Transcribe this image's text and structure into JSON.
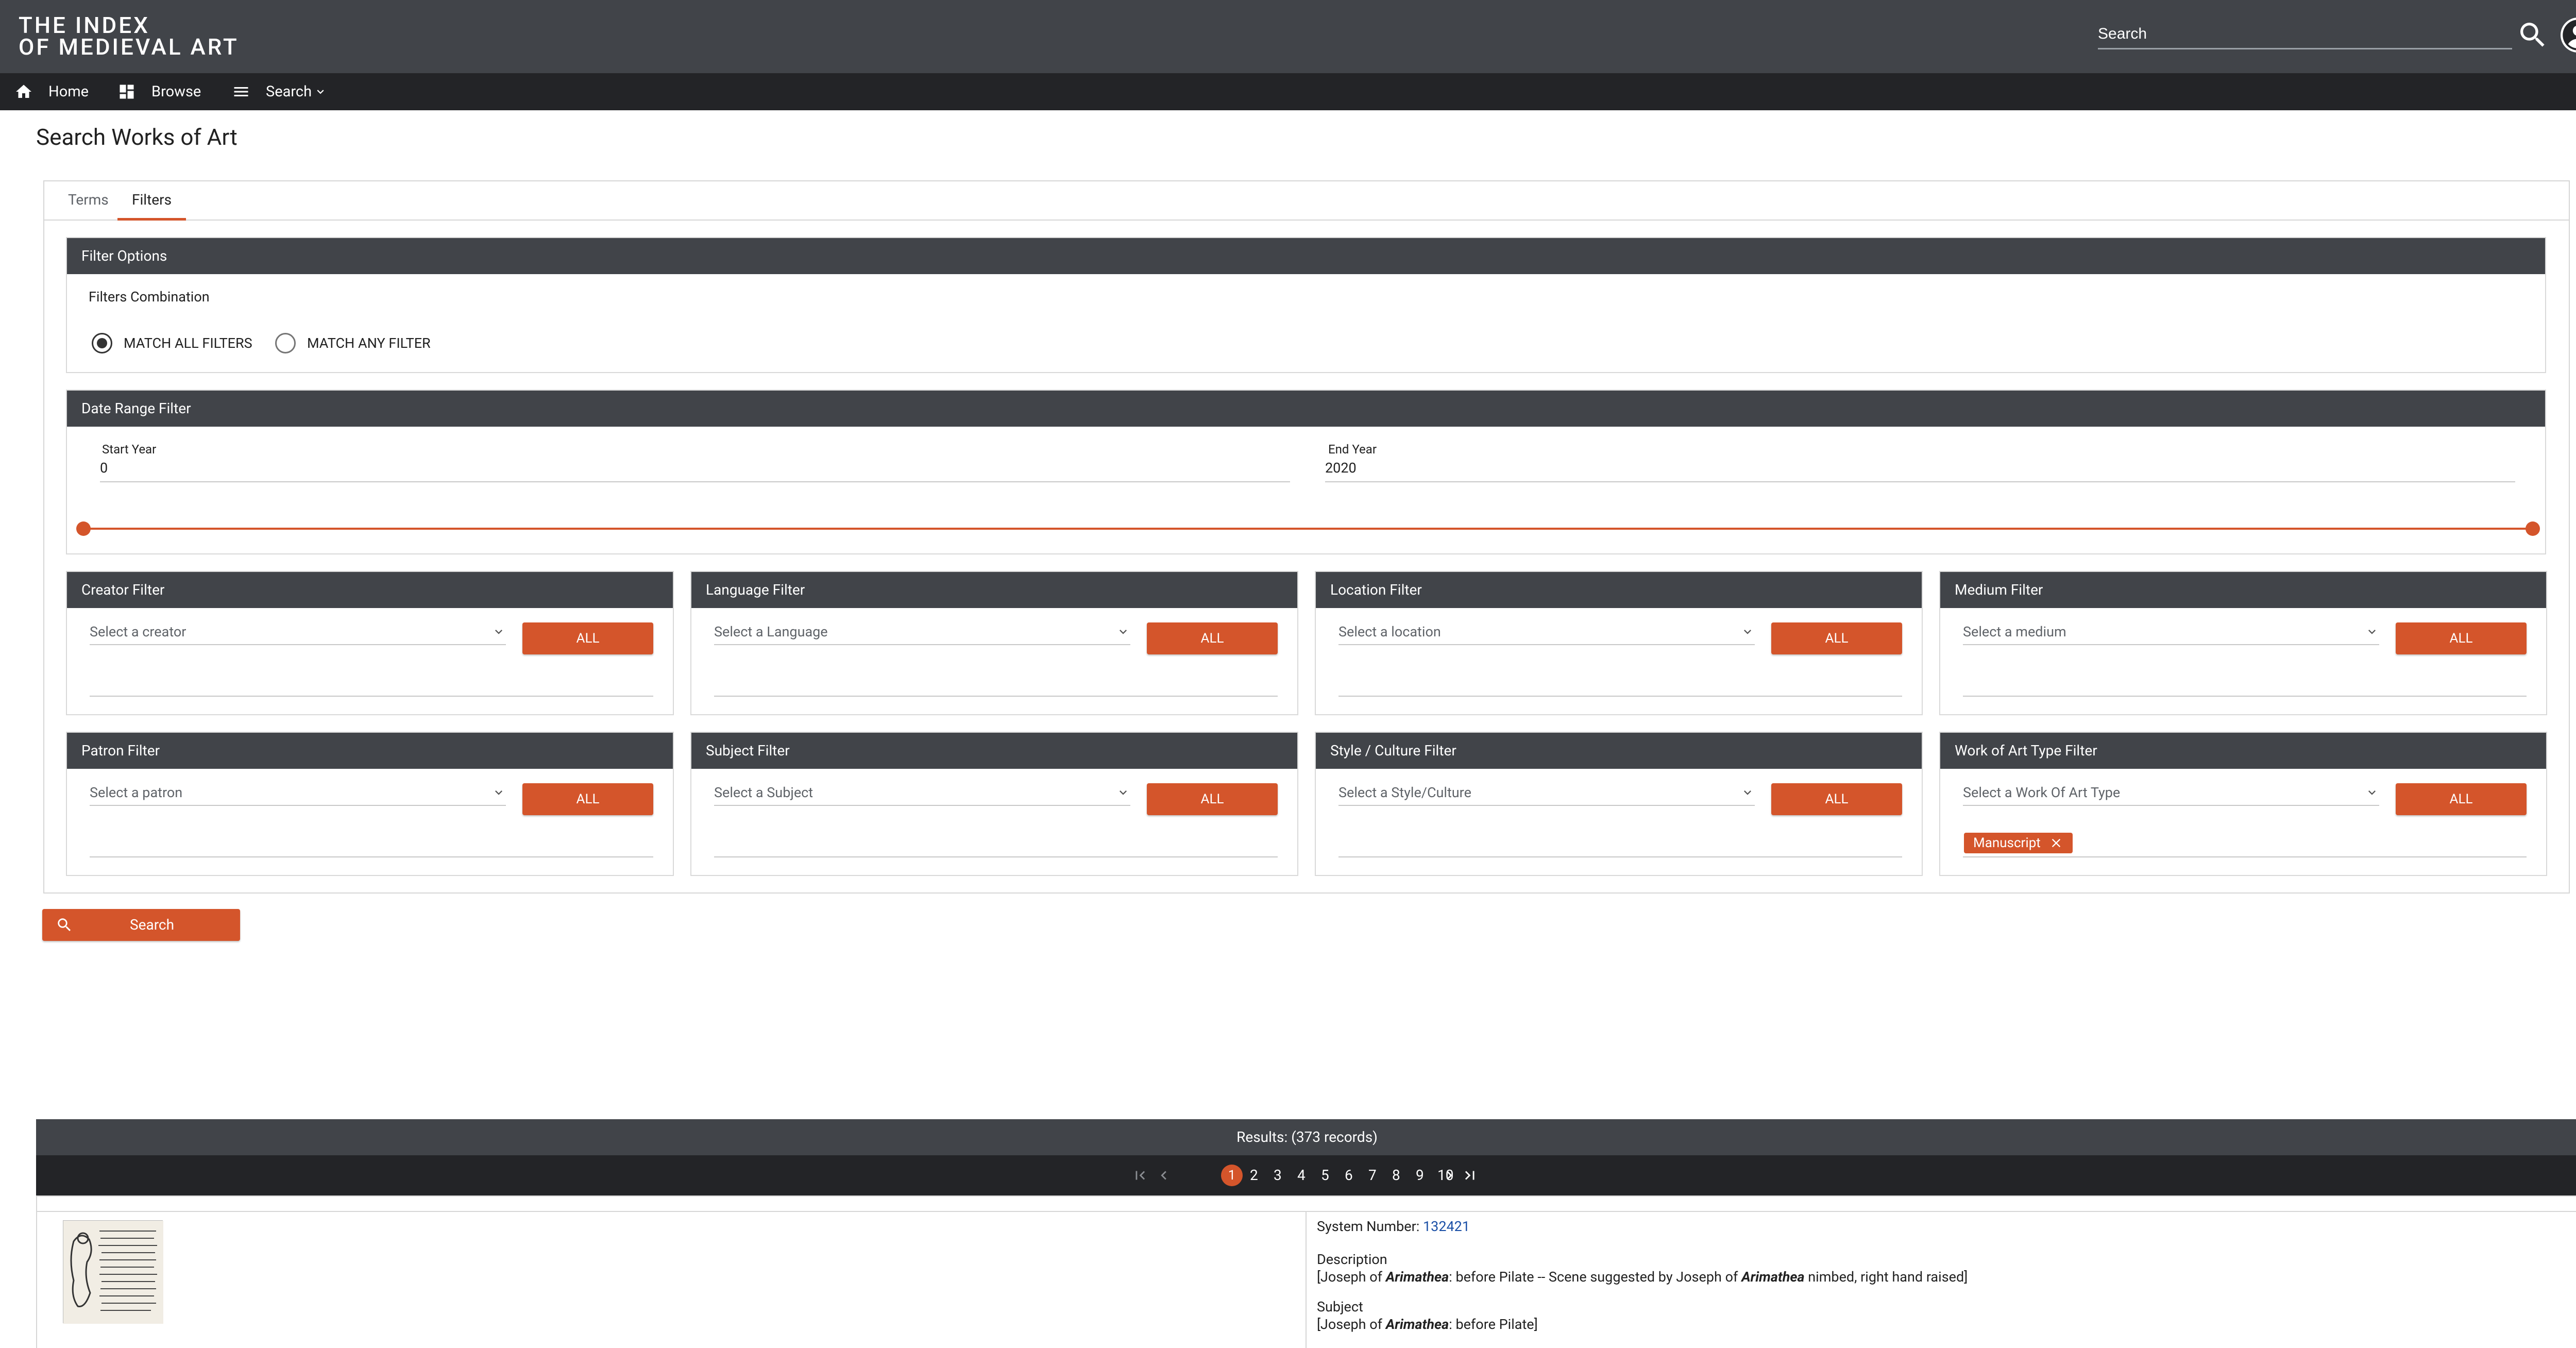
{
  "app": {
    "logo_line1": "THE INDEX",
    "logo_line2": "OF MEDIEVAL ART",
    "search_placeholder": "Search"
  },
  "nav": {
    "home": "Home",
    "browse": "Browse",
    "search": "Search"
  },
  "page": {
    "title": "Search Works of Art",
    "tabs": [
      "Terms",
      "Filters"
    ],
    "active_tab": "Filters"
  },
  "filter_options": {
    "title": "Filter Options",
    "combination_label": "Filters Combination",
    "match_all": "MATCH ALL FILTERS",
    "match_any": "MATCH ANY FILTER",
    "selected": "MATCH ALL FILTERS"
  },
  "date_range": {
    "title": "Date Range Filter",
    "start_label": "Start Year",
    "start_value": "0",
    "end_label": "End Year",
    "end_value": "2020"
  },
  "filters": [
    {
      "title": "Creator Filter",
      "placeholder": "Select a creator",
      "button": "ALL"
    },
    {
      "title": "Language Filter",
      "placeholder": "Select a Language",
      "button": "ALL"
    },
    {
      "title": "Location Filter",
      "placeholder": "Select a location",
      "button": "ALL"
    },
    {
      "title": "Medium Filter",
      "placeholder": "Select a medium",
      "button": "ALL"
    },
    {
      "title": "Patron Filter",
      "placeholder": "Select a patron",
      "button": "ALL"
    },
    {
      "title": "Subject Filter",
      "placeholder": "Select a Subject",
      "button": "ALL"
    },
    {
      "title": "Style / Culture Filter",
      "placeholder": "Select a Style/Culture",
      "button": "ALL"
    },
    {
      "title": "Work of Art Type Filter",
      "placeholder": "Select a Work Of Art Type",
      "button": "ALL",
      "chip": "Manuscript"
    }
  ],
  "search_button": "Search",
  "results": {
    "header": "Results: (373 records)",
    "pages": [
      "1",
      "2",
      "3",
      "4",
      "5",
      "6",
      "7",
      "8",
      "9",
      "10"
    ],
    "current_page": "1",
    "item": {
      "system_number_label": "System Number:",
      "system_number": "132421",
      "description_label": "Description",
      "description_pre": "[Joseph of ",
      "description_em1": "Arimathea",
      "description_mid": ": before Pilate -- Scene suggested by Joseph of ",
      "description_em2": "Arimathea",
      "description_post": " nimbed, right hand raised]",
      "subject_label": "Subject",
      "subject_pre": "[Joseph of ",
      "subject_em": "Arimathea",
      "subject_post": ": before Pilate]"
    }
  },
  "colors": {
    "accent": "#d4552b",
    "header_bg": "#414449",
    "nav_bg": "#232427"
  }
}
